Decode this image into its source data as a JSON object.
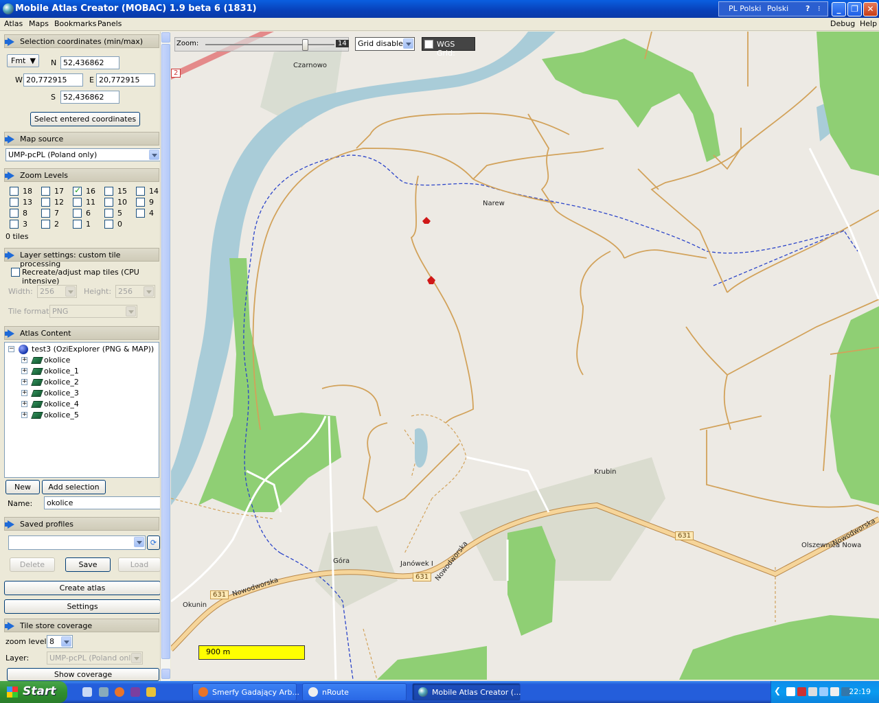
{
  "window": {
    "title": "Mobile Atlas Creator (MOBAC) 1.9 beta 6 (1831)"
  },
  "langbar": {
    "lang1": "PL Polski",
    "lang2": "Polski"
  },
  "menu": {
    "atlas": "Atlas",
    "maps": "Maps",
    "bookmarks": "Bookmarks",
    "panels": "Panels",
    "debug": "Debug",
    "help": "Help"
  },
  "selection": {
    "header": "Selection coordinates (min/max)",
    "fmt": "Fmt",
    "n_label": "N",
    "n_value": "52,436862",
    "w_label": "W",
    "w_value": "20,772915",
    "e_label": "E",
    "e_value": "20,772915",
    "s_label": "S",
    "s_value": "52,436862",
    "select_button": "Select entered coordinates"
  },
  "mapsource": {
    "header": "Map source",
    "value": "UMP-pcPL (Poland only)"
  },
  "zoom": {
    "header": "Zoom Levels",
    "levels": [
      {
        "label": "18",
        "checked": false
      },
      {
        "label": "17",
        "checked": false
      },
      {
        "label": "16",
        "checked": true
      },
      {
        "label": "15",
        "checked": false
      },
      {
        "label": "14",
        "checked": false
      },
      {
        "label": "13",
        "checked": false
      },
      {
        "label": "12",
        "checked": false
      },
      {
        "label": "11",
        "checked": false
      },
      {
        "label": "10",
        "checked": false
      },
      {
        "label": "9",
        "checked": false
      },
      {
        "label": "8",
        "checked": false
      },
      {
        "label": "7",
        "checked": false
      },
      {
        "label": "6",
        "checked": false
      },
      {
        "label": "5",
        "checked": false
      },
      {
        "label": "4",
        "checked": false
      },
      {
        "label": "3",
        "checked": false
      },
      {
        "label": "2",
        "checked": false
      },
      {
        "label": "1",
        "checked": false
      },
      {
        "label": "0",
        "checked": false
      }
    ],
    "tiles": "0 tiles"
  },
  "layer": {
    "header": "Layer settings: custom tile processing",
    "recreate": "Recreate/adjust map tiles (CPU intensive)",
    "width_label": "Width:",
    "width_value": "256",
    "height_label": "Height:",
    "height_value": "256",
    "format_label": "Tile format:",
    "format_value": "PNG"
  },
  "atlas": {
    "header": "Atlas Content",
    "root": "test3 (OziExplorer (PNG & MAP))",
    "items": [
      "okolice",
      "okolice_1",
      "okolice_2",
      "okolice_3",
      "okolice_4",
      "okolice_5"
    ],
    "new_button": "New",
    "add_button": "Add selection",
    "name_label": "Name:",
    "name_value": "okolice"
  },
  "profiles": {
    "header": "Saved profiles",
    "value": "",
    "delete": "Delete",
    "save": "Save",
    "load": "Load"
  },
  "actions": {
    "create": "Create atlas",
    "settings": "Settings"
  },
  "coverage": {
    "header": "Tile store coverage",
    "zoom_label": "zoom level:",
    "zoom_value": "8",
    "layer_label": "Layer:",
    "layer_value": "UMP-pcPL (Poland only)",
    "show_button": "Show coverage"
  },
  "mapview": {
    "zoom_label": "Zoom:",
    "zoom_value": "14",
    "zoom_fraction": 0.77,
    "grid_value": "Grid disabled",
    "wgs_label": "WGS Grid:",
    "scale": "900 m",
    "labels": {
      "czarnowo": "Czarnowo",
      "narew": "Narew",
      "krubin": "Krubin",
      "gora": "Góra",
      "janowek": "Janówek I",
      "okunin": "Okunin",
      "olszewnica": "Olszewnica Nowa",
      "nowodworska1": "Nowodworska",
      "nowodworska2": "Nowodworska",
      "nowodworska3": "Nowodworska",
      "road631a": "631",
      "road631b": "631",
      "road631c": "631",
      "road2": "2"
    }
  },
  "taskbar": {
    "start": "Start",
    "tasks": [
      "Smerfy Gadający Arb...",
      "nRoute",
      "Mobile Atlas Creator (..."
    ],
    "clock": "22:19"
  },
  "colors": {
    "titlebar": "#0a5fe0",
    "map_bg": "#edeae4",
    "forest": "#8fcf74",
    "river": "#a9ccd8",
    "road": "#d2a25a",
    "boundary": "#2b44c9"
  }
}
